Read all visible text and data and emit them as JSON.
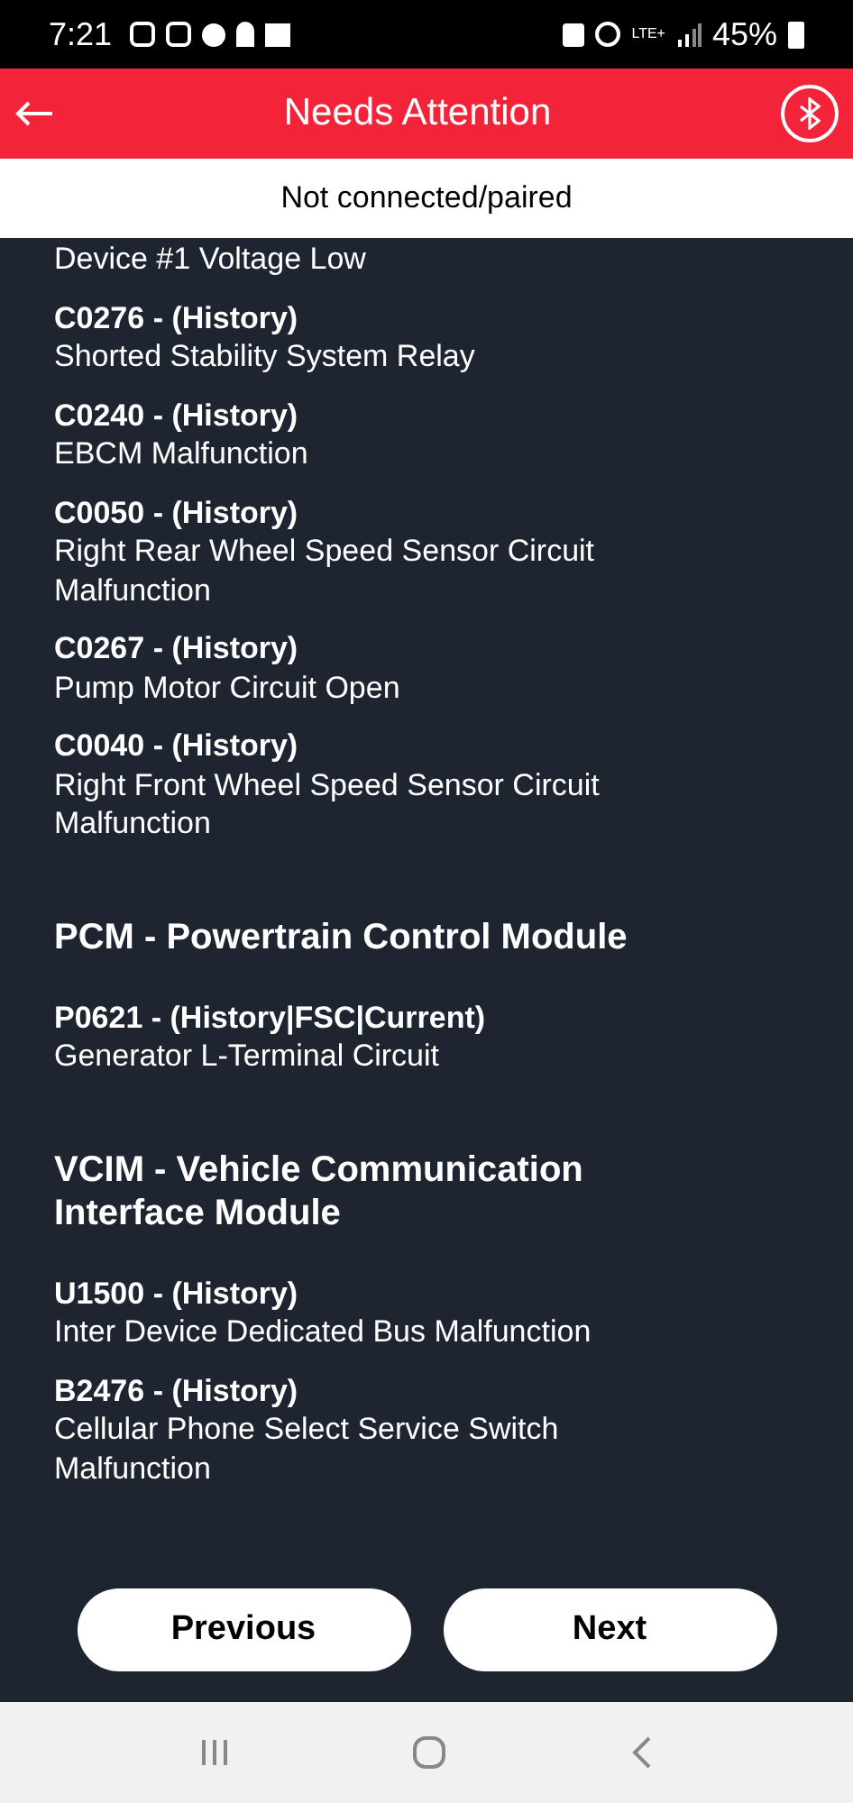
{
  "status_bar": {
    "time": "7:21",
    "network": "LTE+",
    "battery": "45%"
  },
  "header": {
    "title": "Needs Attention"
  },
  "connection": {
    "text": "Not connected/paired"
  },
  "sections": [
    {
      "faults": [
        {
          "description": "Device #1 Voltage Low"
        },
        {
          "code": "C0276 - (History)",
          "description": "Shorted Stability System Relay"
        },
        {
          "code": "C0240 - (History)",
          "description": "EBCM Malfunction"
        },
        {
          "code": "C0050 - (History)",
          "description": "Right Rear Wheel Speed Sensor Circuit Malfunction"
        },
        {
          "code": "C0267 - (History)",
          "description": "Pump Motor Circuit Open"
        },
        {
          "code": "C0040 - (History)",
          "description": "Right Front Wheel Speed Sensor Circuit Malfunction"
        }
      ]
    },
    {
      "title": "PCM - Powertrain Control Module",
      "faults": [
        {
          "code": "P0621 - (History|FSC|Current)",
          "description": "Generator L-Terminal Circuit"
        }
      ]
    },
    {
      "title": "VCIM - Vehicle Communication Interface Module",
      "faults": [
        {
          "code": "U1500 - (History)",
          "description": "Inter Device Dedicated Bus Malfunction"
        },
        {
          "code": "B2476 - (History)",
          "description": "Cellular Phone Select Service Switch Malfunction"
        }
      ]
    }
  ],
  "buttons": [
    "Previous",
    "Next"
  ]
}
